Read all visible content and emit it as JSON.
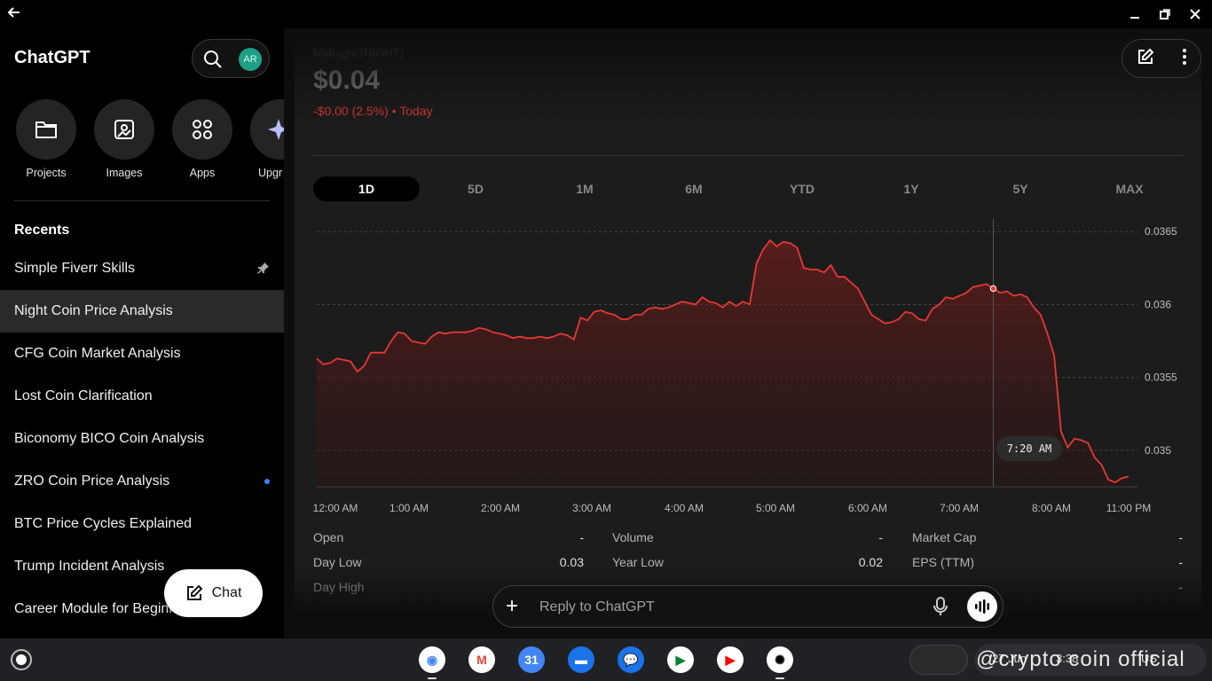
{
  "window": {
    "back_icon": "arrow-left-icon"
  },
  "sidebar": {
    "brand": "ChatGPT",
    "avatar_initials": "AR",
    "quick_actions": [
      {
        "label": "Projects",
        "icon": "folder-icon"
      },
      {
        "label": "Images",
        "icon": "image-icon"
      },
      {
        "label": "Apps",
        "icon": "apps-grid-icon"
      },
      {
        "label": "Upgr",
        "icon": "sparkle-icon"
      }
    ],
    "recents_heading": "Recents",
    "recents": [
      {
        "label": "Simple Fiverr Skills"
      },
      {
        "label": "Night Coin Price Analysis"
      },
      {
        "label": "CFG Coin Market Analysis"
      },
      {
        "label": "Lost Coin Clarification"
      },
      {
        "label": "Biconomy BICO Coin Analysis"
      },
      {
        "label": "ZRO Coin Price Analysis"
      },
      {
        "label": "BTC Price Cycles Explained"
      },
      {
        "label": "Trump Incident Analysis"
      },
      {
        "label": "Career Module for Beginn"
      }
    ],
    "chat_button": "Chat"
  },
  "stock": {
    "name": "Midnight (NIGHT)",
    "price": "$0.04",
    "change": "-$0.00 (2.5%) • Today"
  },
  "ranges": [
    "1D",
    "5D",
    "1M",
    "6M",
    "YTD",
    "1Y",
    "5Y",
    "MAX"
  ],
  "selected_range": "1D",
  "chart_data": {
    "type": "area",
    "color": "#e53935",
    "x_ticks": [
      "12:00 AM",
      "1:00 AM",
      "2:00 AM",
      "3:00 AM",
      "4:00 AM",
      "5:00 AM",
      "6:00 AM",
      "7:00 AM",
      "8:00 AM",
      "11:00 PM"
    ],
    "y_ticks": [
      "0.0365",
      "0.036",
      "0.0355",
      "0.035"
    ],
    "ylim": [
      0.03475,
      0.03655
    ],
    "values": [
      0.03563,
      0.03559,
      0.0356,
      0.03563,
      0.03562,
      0.03561,
      0.03554,
      0.03558,
      0.03567,
      0.03567,
      0.03567,
      0.03575,
      0.03581,
      0.0358,
      0.03575,
      0.03574,
      0.03573,
      0.03578,
      0.03581,
      0.0358,
      0.03581,
      0.03581,
      0.03581,
      0.03582,
      0.03584,
      0.03583,
      0.03581,
      0.0358,
      0.03579,
      0.03577,
      0.03578,
      0.03577,
      0.03577,
      0.03578,
      0.03577,
      0.03578,
      0.0358,
      0.03579,
      0.03576,
      0.03591,
      0.03589,
      0.03595,
      0.03596,
      0.03594,
      0.03593,
      0.0359,
      0.0359,
      0.03593,
      0.03593,
      0.03597,
      0.03598,
      0.03597,
      0.03598,
      0.036,
      0.03602,
      0.03601,
      0.036,
      0.03605,
      0.03602,
      0.03601,
      0.03598,
      0.03602,
      0.03599,
      0.03602,
      0.036,
      0.03628,
      0.03638,
      0.03644,
      0.0364,
      0.03643,
      0.03642,
      0.03639,
      0.03625,
      0.03624,
      0.03624,
      0.03622,
      0.03627,
      0.03619,
      0.03619,
      0.03615,
      0.03611,
      0.03602,
      0.03593,
      0.0359,
      0.03587,
      0.03588,
      0.0359,
      0.03595,
      0.03594,
      0.0359,
      0.03589,
      0.03597,
      0.036,
      0.03605,
      0.03604,
      0.03606,
      0.03608,
      0.03612,
      0.03613,
      0.03614,
      0.03611,
      0.03608,
      0.03609,
      0.03606,
      0.03607,
      0.03605,
      0.03598,
      0.03593,
      0.0358,
      0.03565,
      0.03513,
      0.03502,
      0.03508,
      0.03507,
      0.03505,
      0.03495,
      0.0349,
      0.0348,
      0.03478,
      0.03481,
      0.03482
    ],
    "hover_label": "7:20 AM"
  },
  "stats": [
    {
      "label": "Open",
      "value": "-"
    },
    {
      "label": "Volume",
      "value": "-"
    },
    {
      "label": "Market Cap",
      "value": "-"
    },
    {
      "label": "Day Low",
      "value": "0.03"
    },
    {
      "label": "Year Low",
      "value": "0.02"
    },
    {
      "label": "EPS (TTM)",
      "value": "-"
    },
    {
      "label": "Day High",
      "value": ""
    },
    {
      "label": "",
      "value": "-"
    }
  ],
  "composer": {
    "placeholder": "Reply to ChatGPT"
  },
  "shelf": {
    "apps": [
      {
        "name": "chrome-icon",
        "bg": "#fff",
        "fg": "#4285f4",
        "glyph": "◉"
      },
      {
        "name": "gmail-icon",
        "bg": "#fff",
        "fg": "#ea4335",
        "glyph": "M"
      },
      {
        "name": "calendar-icon",
        "bg": "#4285f4",
        "fg": "#fff",
        "glyph": "31"
      },
      {
        "name": "files-icon",
        "bg": "#1a73e8",
        "fg": "#fff",
        "glyph": "▬"
      },
      {
        "name": "messages-icon",
        "bg": "#1a73e8",
        "fg": "#fff",
        "glyph": "💬"
      },
      {
        "name": "meet-icon",
        "bg": "#fff",
        "fg": "#00832d",
        "glyph": "▶"
      },
      {
        "name": "youtube-icon",
        "bg": "#fff",
        "fg": "#ff0000",
        "glyph": "▶"
      },
      {
        "name": "chatgpt-icon",
        "bg": "#fff",
        "fg": "#000",
        "glyph": "✺"
      }
    ],
    "watermark": "@crypto coin official",
    "tray_items": [
      "27 Jun",
      "3:38",
      "US"
    ]
  }
}
